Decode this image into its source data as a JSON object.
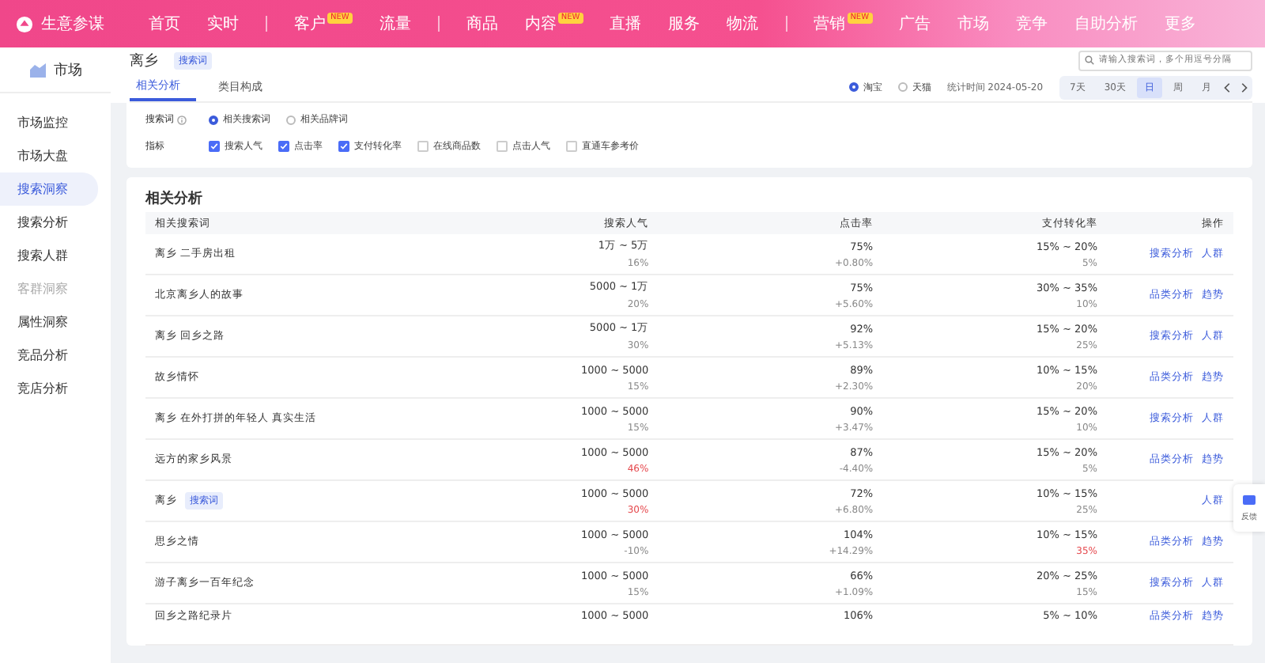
{
  "nav": {
    "logo": "生意参谋",
    "groups": [
      [
        {
          "label": "首页"
        },
        {
          "label": "实时"
        }
      ],
      [
        {
          "label": "客户",
          "badge": "NEW"
        },
        {
          "label": "流量"
        }
      ],
      [
        {
          "label": "商品"
        },
        {
          "label": "内容",
          "badge": "NEW"
        },
        {
          "label": "直播"
        },
        {
          "label": "服务"
        },
        {
          "label": "物流"
        }
      ],
      [
        {
          "label": "营销",
          "badge": "NEW"
        },
        {
          "label": "广告"
        },
        {
          "label": "市场"
        },
        {
          "label": "竞争"
        },
        {
          "label": "自助分析"
        },
        {
          "label": "更多"
        }
      ]
    ]
  },
  "sidebar": {
    "title": "市场",
    "items": [
      {
        "kind": "item",
        "label": "市场监控",
        "selected": false
      },
      {
        "kind": "item",
        "label": "市场大盘",
        "selected": false
      },
      {
        "kind": "item",
        "label": "搜索洞察",
        "selected": true
      },
      {
        "kind": "item",
        "label": "搜索分析",
        "selected": false
      },
      {
        "kind": "item",
        "label": "搜索人群",
        "selected": false
      },
      {
        "kind": "group",
        "label": "客群洞察"
      },
      {
        "kind": "item",
        "label": "属性洞察",
        "selected": false
      },
      {
        "kind": "item",
        "label": "竞品分析",
        "selected": false
      },
      {
        "kind": "item",
        "label": "竞店分析",
        "selected": false
      }
    ]
  },
  "header": {
    "keyword": "离乡",
    "tag": "搜索词",
    "search": {
      "placeholder": "请输入搜索词，多个用逗号分隔"
    }
  },
  "tabs": [
    {
      "label": "相关分析",
      "selected": true
    },
    {
      "label": "类目构成",
      "selected": false
    }
  ],
  "scope": [
    {
      "label": "淘宝",
      "selected": true
    },
    {
      "label": "天猫",
      "selected": false
    }
  ],
  "date": "统计时间 2024-05-20",
  "periods": [
    {
      "label": "7天",
      "selected": false
    },
    {
      "label": "30天",
      "selected": false
    },
    {
      "label": "日",
      "selected": true
    },
    {
      "label": "周",
      "selected": false
    },
    {
      "label": "月",
      "selected": false
    }
  ],
  "filters": {
    "word_label": "搜索词",
    "word_types": [
      {
        "label": "相关搜索词",
        "selected": true
      },
      {
        "label": "相关品牌词",
        "selected": false
      }
    ],
    "metric_label": "指标",
    "metrics": [
      {
        "label": "搜索人气",
        "checked": true
      },
      {
        "label": "点击率",
        "checked": true
      },
      {
        "label": "支付转化率",
        "checked": true
      },
      {
        "label": "在线商品数",
        "checked": false
      },
      {
        "label": "点击人气",
        "checked": false
      },
      {
        "label": "直通车参考价",
        "checked": false
      }
    ]
  },
  "table": {
    "title": "相关分析",
    "columns": [
      "相关搜索词",
      "搜索人气",
      "点击率",
      "支付转化率",
      "操作"
    ],
    "rows": [
      {
        "name": "离乡 二手房出租",
        "popularity": "1万 ~ 5万",
        "pop_change": {
          "text": "16%",
          "warn": false
        },
        "ctr": "75%",
        "ctr_change": "+0.80%",
        "cvr": "15% ~ 20%",
        "cvr_change": {
          "text": "5%",
          "warn": false
        },
        "actions": [
          "搜索分析",
          "人群"
        ]
      },
      {
        "name": "北京离乡人的故事",
        "popularity": "5000 ~ 1万",
        "pop_change": {
          "text": "20%",
          "warn": false
        },
        "ctr": "75%",
        "ctr_change": "+5.60%",
        "cvr": "30% ~ 35%",
        "cvr_change": {
          "text": "10%",
          "warn": false
        },
        "actions": [
          "品类分析",
          "趋势"
        ]
      },
      {
        "name": "离乡 回乡之路",
        "popularity": "5000 ~ 1万",
        "pop_change": {
          "text": "30%",
          "warn": false
        },
        "ctr": "92%",
        "ctr_change": "+5.13%",
        "cvr": "15% ~ 20%",
        "cvr_change": {
          "text": "25%",
          "warn": false
        },
        "actions": [
          "搜索分析",
          "人群"
        ]
      },
      {
        "name": "故乡情怀",
        "popularity": "1000 ~ 5000",
        "pop_change": {
          "text": "15%",
          "warn": false
        },
        "ctr": "89%",
        "ctr_change": "+2.30%",
        "cvr": "10% ~ 15%",
        "cvr_change": {
          "text": "20%",
          "warn": false
        },
        "actions": [
          "品类分析",
          "趋势"
        ]
      },
      {
        "name": "离乡 在外打拼的年轻人 真实生活",
        "popularity": "1000 ~ 5000",
        "pop_change": {
          "text": "15%",
          "warn": false
        },
        "ctr": "90%",
        "ctr_change": "+3.47%",
        "cvr": "15% ~ 20%",
        "cvr_change": {
          "text": "10%",
          "warn": false
        },
        "actions": [
          "搜索分析",
          "人群"
        ]
      },
      {
        "name": "远方的家乡风景",
        "popularity": "1000 ~ 5000",
        "pop_change": {
          "text": "46%",
          "warn": true
        },
        "ctr": "87%",
        "ctr_change": "-4.40%",
        "cvr": "15% ~ 20%",
        "cvr_change": {
          "text": "5%",
          "warn": false
        },
        "actions": [
          "品类分析",
          "趋势"
        ]
      },
      {
        "name": "离乡",
        "tag": "搜索词",
        "popularity": "1000 ~ 5000",
        "pop_change": {
          "text": "30%",
          "warn": true
        },
        "ctr": "72%",
        "ctr_change": "+6.80%",
        "cvr": "10% ~ 15%",
        "cvr_change": {
          "text": "25%",
          "warn": false
        },
        "actions": [
          "人群"
        ]
      },
      {
        "name": "思乡之情",
        "popularity": "1000 ~ 5000",
        "pop_change": {
          "text": "-10%",
          "warn": false
        },
        "ctr": "104%",
        "ctr_change": "+14.29%",
        "cvr": "10% ~ 15%",
        "cvr_change": {
          "text": "35%",
          "warn": true
        },
        "actions": [
          "品类分析",
          "趋势"
        ]
      },
      {
        "name": "游子离乡一百年纪念",
        "popularity": "1000 ~ 5000",
        "pop_change": {
          "text": "15%",
          "warn": false
        },
        "ctr": "66%",
        "ctr_change": "+1.09%",
        "cvr": "20% ~ 25%",
        "cvr_change": {
          "text": "15%",
          "warn": false
        },
        "actions": [
          "搜索分析",
          "人群"
        ]
      },
      {
        "name": "回乡之路纪录片",
        "popularity": "1000 ~ 5000",
        "ctr": "106%",
        "cvr": "5% ~ 10%",
        "actions": [
          "品类分析",
          "趋势"
        ]
      }
    ]
  },
  "feedback": {
    "label": "反馈"
  }
}
